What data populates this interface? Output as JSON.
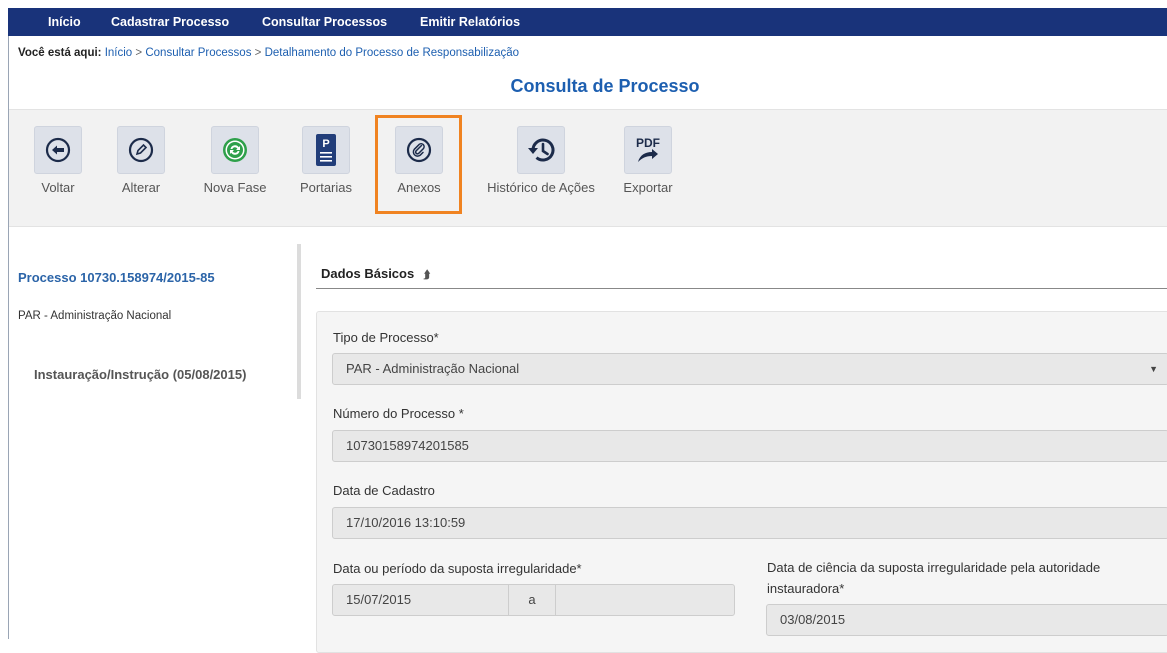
{
  "nav": {
    "items": [
      "Início",
      "Cadastrar Processo",
      "Consultar Processos",
      "Emitir Relatórios"
    ]
  },
  "breadcrumb": {
    "label": "Você está aqui:",
    "items": [
      "Início",
      "Consultar Processos",
      "Detalhamento do Processo de Responsabilização"
    ],
    "separator": ">"
  },
  "page": {
    "title": "Consulta de Processo"
  },
  "toolbar": {
    "buttons": [
      {
        "label": "Voltar",
        "icon": "arrow-left-icon"
      },
      {
        "label": "Alterar",
        "icon": "pencil-icon"
      },
      {
        "label": "Nova Fase",
        "icon": "refresh-icon"
      },
      {
        "label": "Portarias",
        "icon": "document-p-icon"
      },
      {
        "label": "Anexos",
        "icon": "paperclip-icon"
      },
      {
        "label": "Histórico de Ações",
        "icon": "history-icon"
      },
      {
        "label": "Exportar",
        "icon": "pdf-export-icon"
      }
    ],
    "highlighted": "Anexos",
    "highlight_color": "#f08321"
  },
  "sidebar": {
    "process_title": "Processo 10730.158974/2015-85",
    "process_type": "PAR - Administração Nacional",
    "phase": "Instauração/Instrução (05/08/2015)"
  },
  "section": {
    "title": "Dados Básicos",
    "toggle_icon": "chevron-double-up-icon",
    "fields": {
      "tipo_label": "Tipo de Processo*",
      "tipo_value": "PAR - Administração Nacional",
      "numero_label": "Número do Processo *",
      "numero_value": "10730158974201585",
      "cadastro_label": "Data de Cadastro",
      "cadastro_value": "17/10/2016 13:10:59",
      "periodo_label": "Data ou período da suposta irregularidade*",
      "periodo_start": "15/07/2015",
      "periodo_sep": "a",
      "periodo_end": "",
      "ciencia_label_1": "Data de ciência da suposta irregularidade pela autoridade",
      "ciencia_label_2": "instauradora*",
      "ciencia_value": "03/08/2015"
    }
  },
  "colors": {
    "nav_bg": "#19337a",
    "accent": "#1d5fb0",
    "highlight": "#f08321"
  }
}
